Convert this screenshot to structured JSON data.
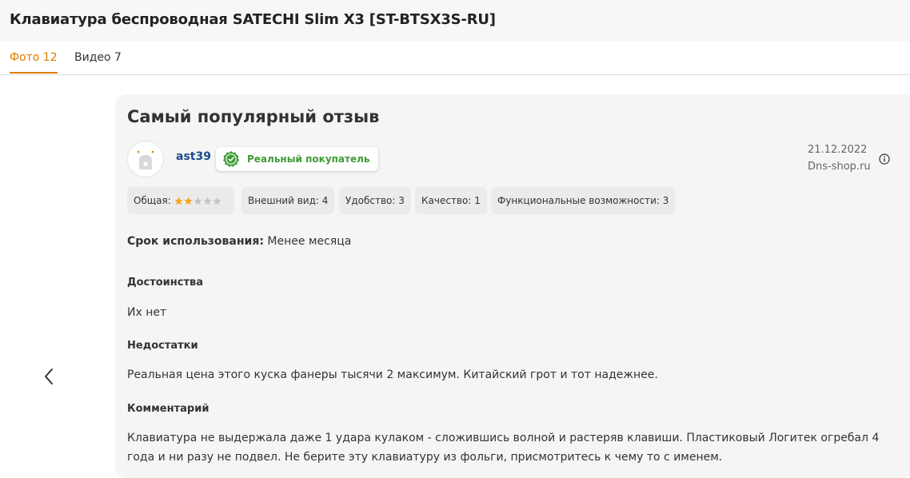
{
  "product": {
    "title": "Клавиатура беспроводная SATECHI Slim X3 [ST-BTSX3S-RU]"
  },
  "tabs": [
    {
      "label": "Фото 12",
      "active": true
    },
    {
      "label": "Видео 7",
      "active": false
    }
  ],
  "review": {
    "heading": "Самый популярный отзыв",
    "author": "ast39",
    "badge": "Реальный покупатель",
    "date": "21.12.2022",
    "source": "Dns-shop.ru",
    "ratings": [
      {
        "label": "Общая:",
        "stars": 2,
        "max": 5
      },
      {
        "label": "Внешний вид: 4"
      },
      {
        "label": "Удобство: 3"
      },
      {
        "label": "Качество: 1"
      },
      {
        "label": "Функциональные возможности: 3"
      }
    ],
    "usage_label": "Срок использования:",
    "usage_value": "Менее месяца",
    "sections": [
      {
        "title": "Достоинства",
        "text": "Их нет"
      },
      {
        "title": "Недостатки",
        "text": "Реальная цена этого куска фанеры тысячи 2 максимум. Китайский грот и тот надежнее."
      },
      {
        "title": "Комментарий",
        "text": "Клавиатура не выдержала даже 1 удара кулаком - сложившись волной и растеряв клавиши. Пластиковый Логитек огребал 4 года и ни разу не подвел. Не берите эту клавиатуру из фольги, присмотритесь к чему то с именем."
      }
    ]
  },
  "colors": {
    "accent": "#e07b00",
    "star_filled": "#f5a623",
    "star_empty": "#c4c4c4",
    "buyer_green": "#3f9c35",
    "username_blue": "#1a4a8a"
  },
  "icons": [
    "chevron-left-icon",
    "shield-check-icon",
    "info-icon",
    "star-icon",
    "avatar-placeholder-icon"
  ]
}
